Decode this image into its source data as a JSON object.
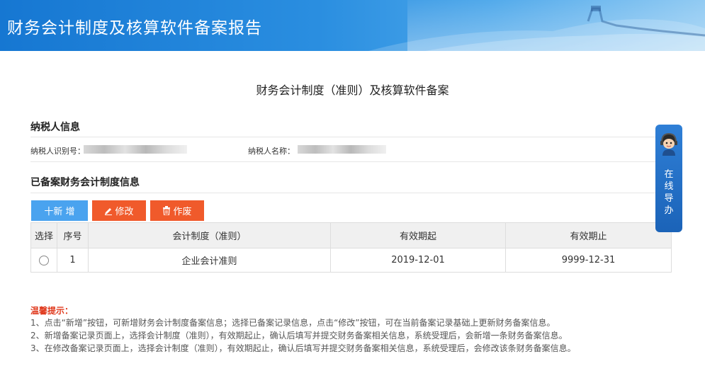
{
  "header": {
    "title": "财务会计制度及核算软件备案报告"
  },
  "page_title": "财务会计制度（准则）及核算软件备案",
  "taxpayer": {
    "section_title": "纳税人信息",
    "id_label": "纳税人识别号：",
    "name_label": "纳税人名称："
  },
  "records": {
    "section_title": "已备案财务会计制度信息",
    "buttons": {
      "add": "十新 增",
      "edit": "修改",
      "void": "作废"
    },
    "columns": [
      "选择",
      "序号",
      "会计制度（准则）",
      "有效期起",
      "有效期止"
    ],
    "rows": [
      {
        "index": "1",
        "system": "企业会计准则",
        "start": "2019-12-01",
        "end": "9999-12-31"
      }
    ]
  },
  "tips": {
    "title": "温馨提示：",
    "items": [
      "1、点击“新增”按钮，可新增财务会计制度备案信息；选择已备案记录信息，点击“修改”按钮，可在当前备案记录基础上更新财务备案信息。",
      "2、新增备案记录页面上，选择会计制度（准则），有效期起止，确认后填写并提交财务备案相关信息，系统受理后，会新增一条财务备案信息。",
      "3、在修改备案记录页面上，选择会计制度（准则），有效期起止，确认后填写并提交财务备案相关信息，系统受理后，会修改该条财务备案信息。"
    ]
  },
  "guide": {
    "label": "在线导办",
    "icon": "assistant-avatar-icon"
  },
  "colors": {
    "accent_blue": "#4aa3ef",
    "action_orange": "#f05a2b",
    "tip_red": "#e03a1e",
    "banner_blue": "#1677d2"
  }
}
